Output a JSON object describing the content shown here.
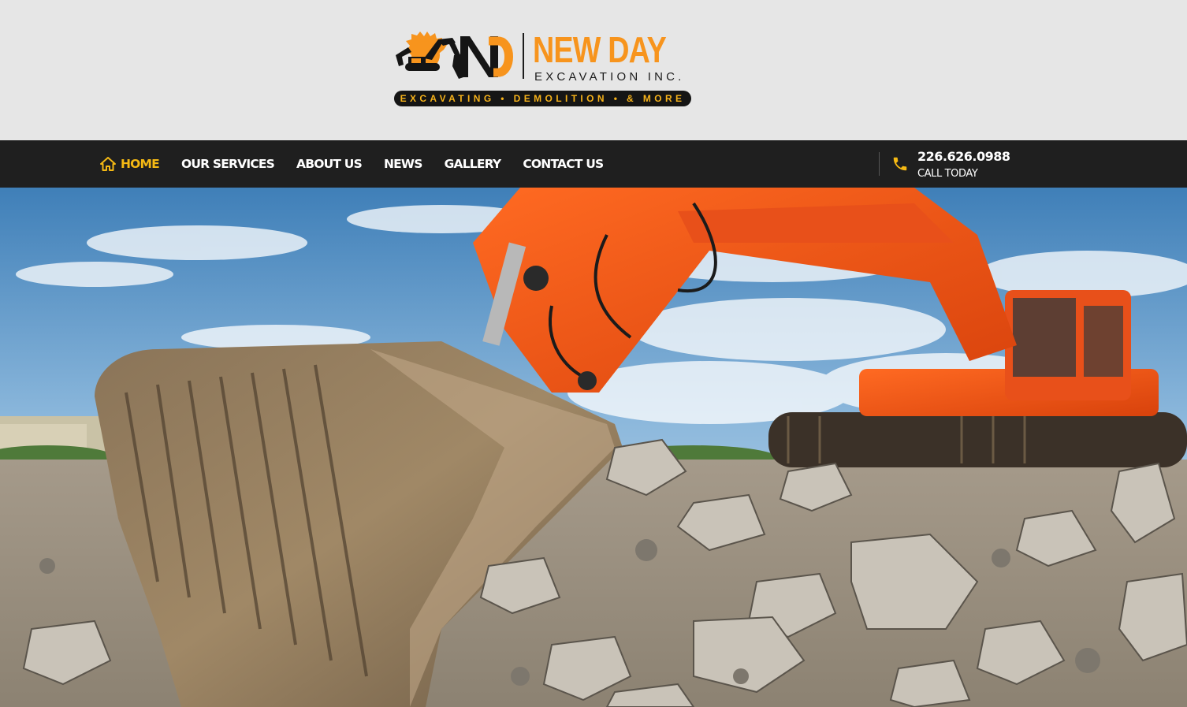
{
  "logo": {
    "name": "NEW DAY",
    "subtitle": "EXCAVATION INC.",
    "tagline": "EXCAVATING • DEMOLITION • & MORE"
  },
  "nav": {
    "items": [
      {
        "label": "HOME",
        "active": true,
        "icon": "home-icon"
      },
      {
        "label": "OUR SERVICES",
        "active": false
      },
      {
        "label": "ABOUT US",
        "active": false
      },
      {
        "label": "NEWS",
        "active": false
      },
      {
        "label": "GALLERY",
        "active": false
      },
      {
        "label": "CONTACT US",
        "active": false
      }
    ]
  },
  "contact": {
    "icon": "phone-icon",
    "phone": "226.626.0988",
    "label": "CALL TODAY"
  },
  "colors": {
    "accent": "#f5b914",
    "brand_orange": "#f7941d",
    "nav_bg": "#1f1f1f",
    "header_bg": "#e6e6e6"
  }
}
